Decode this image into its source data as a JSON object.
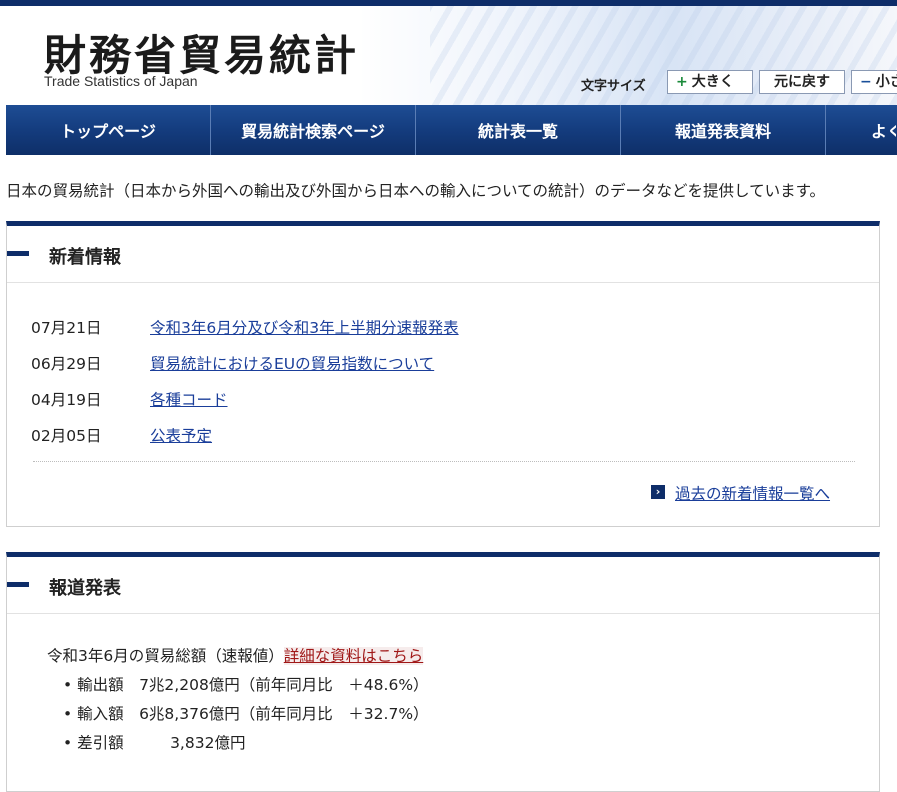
{
  "header": {
    "logo_jp": "財務省貿易統計",
    "logo_en": "Trade Statistics of Japan",
    "font_size_label": "文字サイズ",
    "font_large_sym": "+",
    "font_large": "大きく",
    "font_reset": "元に戻す",
    "font_small_sym": "−",
    "font_small": "小さく"
  },
  "nav": {
    "items": [
      "トップページ",
      "貿易統計検索ページ",
      "統計表一覧",
      "報道発表資料",
      "よくある質問"
    ]
  },
  "intro": "日本の貿易統計（日本から外国への輸出及び外国から日本への輸入についての統計）のデータなどを提供しています。",
  "news": {
    "title": "新着情報",
    "items": [
      {
        "date": "07月21日",
        "text": "令和3年6月分及び令和3年上半期分速報発表"
      },
      {
        "date": "06月29日",
        "text": "貿易統計におけるEUの貿易指数について"
      },
      {
        "date": "04月19日",
        "text": "各種コード"
      },
      {
        "date": "02月05日",
        "text": "公表予定"
      }
    ],
    "more": "過去の新着情報一覧へ",
    "more_icon": "›"
  },
  "report": {
    "title": "報道発表",
    "headline": "令和3年6月の貿易総額（速報値）",
    "detail_link": "詳細な資料はこちら",
    "bullets": [
      "• 輸出額　7兆2,208億円（前年同月比　＋48.6%）",
      "• 輸入額　6兆8,376億円（前年同月比　＋32.7%）",
      "• 差引額　　　3,832億円"
    ]
  }
}
